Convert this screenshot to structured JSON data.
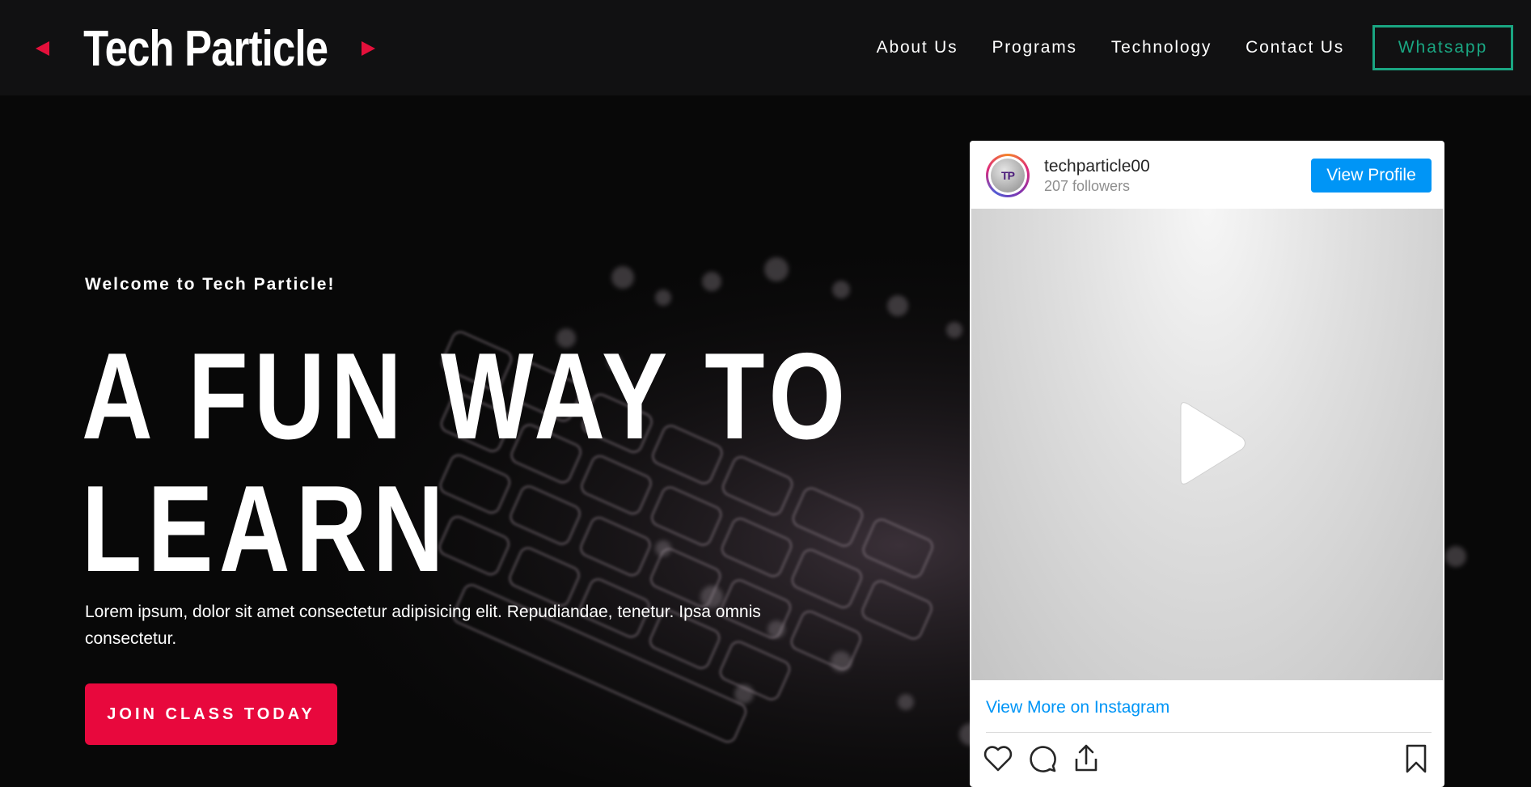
{
  "navbar": {
    "brand": "Tech Particle",
    "links": [
      "About Us",
      "Programs",
      "Technology",
      "Contact Us"
    ],
    "whatsapp_label": "Whatsapp"
  },
  "hero": {
    "welcome": "Welcome to Tech Particle!",
    "headline_line1": "A FUN WAY TO",
    "headline_line2": "LEARN",
    "lead": "Lorem ipsum, dolor sit amet consectetur adipisicing elit. Repudiandae, tenetur. Ipsa omnis consectetur.",
    "cta_label": "JOIN CLASS TODAY"
  },
  "instagram": {
    "avatar_initials": "TP",
    "username": "techparticle00",
    "followers": "207 followers",
    "view_profile_label": "View Profile",
    "view_more_label": "View More on Instagram"
  },
  "icons": {
    "brand_left": "triangle-left-icon",
    "brand_right": "triangle-right-icon",
    "play": "play-icon",
    "like": "heart-icon",
    "comment": "comment-icon",
    "share": "share-icon",
    "save": "bookmark-icon"
  },
  "colors": {
    "accent_red": "#e8083d",
    "whatsapp_green": "#1aa682",
    "instagram_blue": "#0095f6",
    "page_background": "#0a0a0a",
    "navbar_background": "#111112"
  }
}
